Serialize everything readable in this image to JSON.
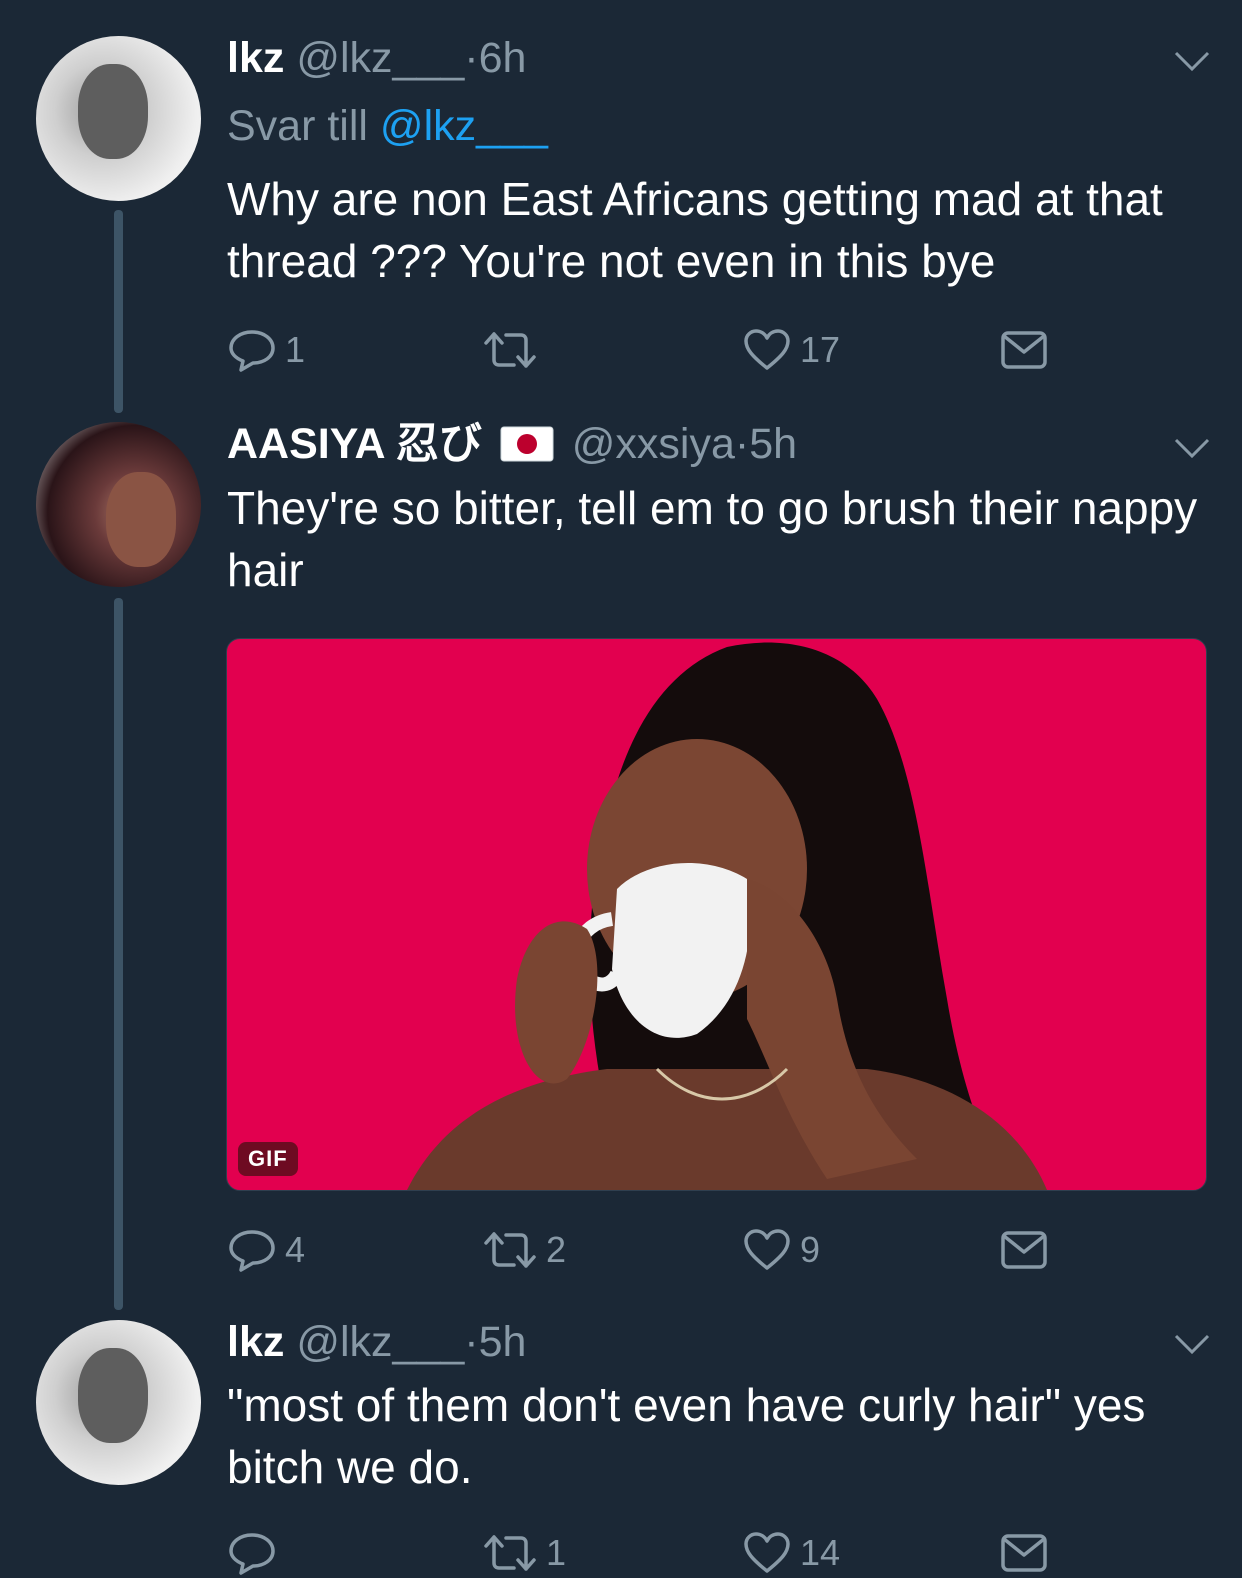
{
  "tweets": [
    {
      "name": "lkz",
      "handle": "@lkz___",
      "dot": "·",
      "time": "6h",
      "reply_prefix": "Svar till",
      "reply_mention": "@lkz___",
      "text": "Why are non East Africans getting mad at that thread ??? You're not even in this bye",
      "replies": "1",
      "retweets": "",
      "likes": "17"
    },
    {
      "name": "AASIYA 忍び",
      "flag": "japan-flag",
      "handle": "@xxsiya",
      "dot": "·",
      "time": "5h",
      "text": "They're so bitter, tell em to go brush their nappy hair",
      "media_badge": "GIF",
      "replies": "4",
      "retweets": "2",
      "likes": "9"
    },
    {
      "name": "lkz",
      "handle": "@lkz___",
      "dot": "·",
      "time": "5h",
      "text": "\"most of them don't even have curly hair\" yes bitch we do.",
      "replies": "",
      "retweets": "1",
      "likes": "14"
    }
  ],
  "colors": {
    "background": "#1b2836",
    "secondary_text": "#8899a6",
    "link": "#1da1f2",
    "gif_background": "#e2004f"
  },
  "icons": [
    "reply-icon",
    "retweet-icon",
    "like-icon",
    "message-icon",
    "chevron-down-icon"
  ]
}
